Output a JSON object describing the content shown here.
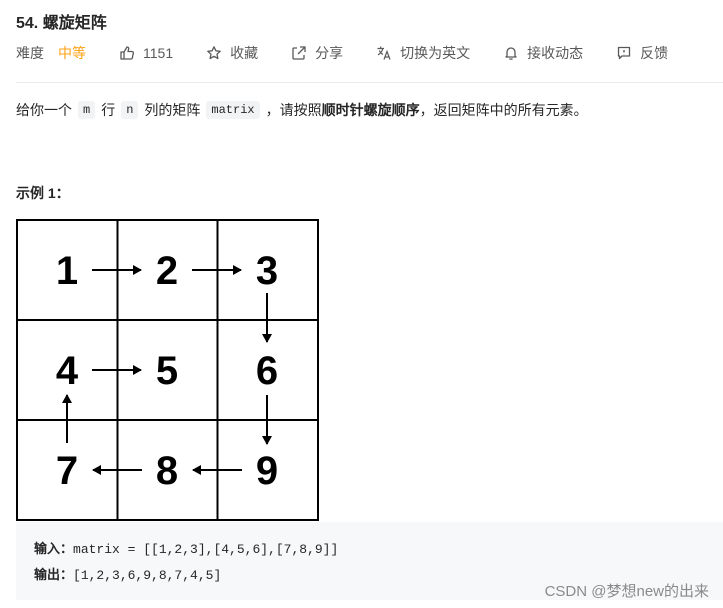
{
  "problem": {
    "title": "54. 螺旋矩阵",
    "difficulty_label": "难度",
    "difficulty": "中等",
    "likes": "1151",
    "actions": [
      "收藏",
      "分享",
      "切换为英文",
      "接收动态",
      "反馈"
    ]
  },
  "description": {
    "p1": "给你一个",
    "code_m": "m",
    "p2": "行",
    "code_n": "n",
    "p3": "列的矩阵",
    "code_matrix": "matrix",
    "p4": "，请按照",
    "bold": "顺时针螺旋顺序",
    "p5": "，返回矩阵中的所有元素。"
  },
  "example": {
    "title": "示例 1：",
    "grid": [
      [
        "1",
        "2",
        "3"
      ],
      [
        "4",
        "5",
        "6"
      ],
      [
        "7",
        "8",
        "9"
      ]
    ],
    "input_label": "输入：",
    "input_value": "matrix = [[1,2,3],[4,5,6],[7,8,9]]",
    "output_label": "输出：",
    "output_value": "[1,2,3,6,9,8,7,4,5]"
  },
  "watermark": "CSDN @梦想new的出来",
  "colors": {
    "difficulty": "#ffa116",
    "text": "#262626",
    "muted": "#595959"
  }
}
